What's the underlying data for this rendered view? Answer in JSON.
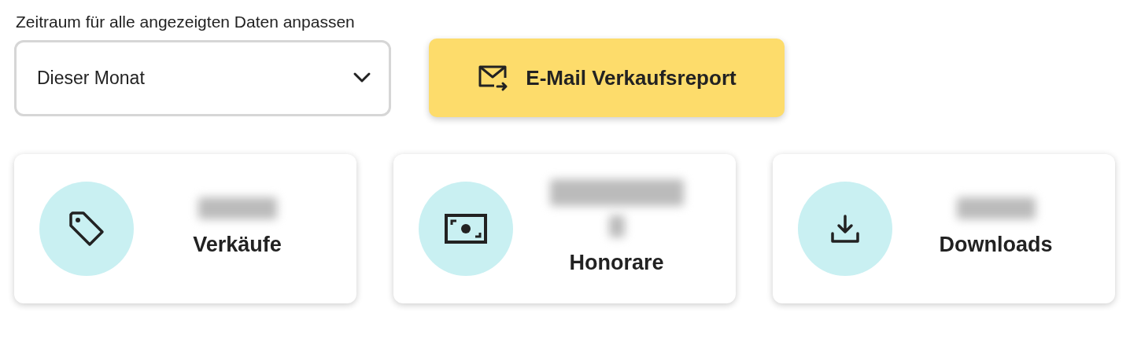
{
  "period_label": "Zeitraum für alle angezeigten Daten anpassen",
  "period_select": {
    "value": "Dieser Monat"
  },
  "email_button": {
    "label": "E-Mail Verkaufsreport"
  },
  "cards": [
    {
      "label": "Verkäufe"
    },
    {
      "label": "Honorare"
    },
    {
      "label": "Downloads"
    }
  ]
}
